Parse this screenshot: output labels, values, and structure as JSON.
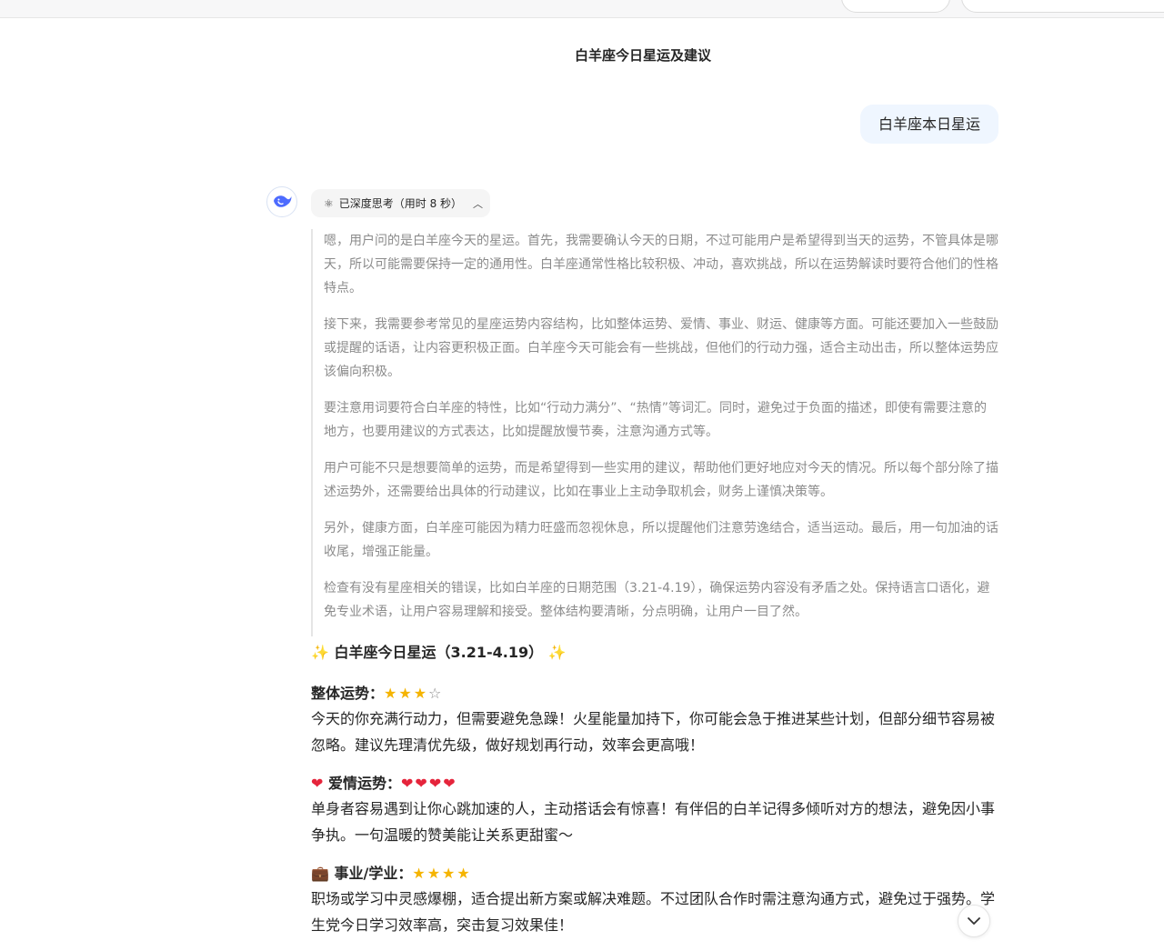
{
  "conversation": {
    "title": "白羊座今日星运及建议"
  },
  "user_message": {
    "text": "白羊座本日星运"
  },
  "assistant": {
    "thinking_label": "已深度思考（用时 8 秒）",
    "thinking_paragraphs": [
      "嗯，用户问的是白羊座今天的星运。首先，我需要确认今天的日期，不过可能用户是希望得到当天的运势，不管具体是哪天，所以可能需要保持一定的通用性。白羊座通常性格比较积极、冲动，喜欢挑战，所以在运势解读时要符合他们的性格特点。",
      "接下来，我需要参考常见的星座运势内容结构，比如整体运势、爱情、事业、财运、健康等方面。可能还要加入一些鼓励或提醒的话语，让内容更积极正面。白羊座今天可能会有一些挑战，但他们的行动力强，适合主动出击，所以整体运势应该偏向积极。",
      "要注意用词要符合白羊座的特性，比如“行动力满分”、“热情”等词汇。同时，避免过于负面的描述，即使有需要注意的地方，也要用建议的方式表达，比如提醒放慢节奏，注意沟通方式等。",
      "用户可能不只是想要简单的运势，而是希望得到一些实用的建议，帮助他们更好地应对今天的情况。所以每个部分除了描述运势外，还需要给出具体的行动建议，比如在事业上主动争取机会，财务上谨慎决策等。",
      "另外，健康方面，白羊座可能因为精力旺盛而忽视休息，所以提醒他们注意劳逸结合，适当运动。最后，用一句加油的话收尾，增强正能量。",
      "检查有没有星座相关的错误，比如白羊座的日期范围（3.21-4.19），确保运势内容没有矛盾之处。保持语言口语化，避免专业术语，让用户容易理解和接受。整体结构要清晰，分点明确，让用户一目了然。"
    ],
    "answer": {
      "heading": "白羊座今日星运（3.21-4.19）",
      "sections": [
        {
          "title": "整体运势：",
          "rating": 3,
          "rating_max": 4,
          "rating_symbol": "star",
          "body": "今天的你充满行动力，但需要避免急躁！火星能量加持下，你可能会急于推进某些计划，但部分细节容易被忽略。建议先理清优先级，做好规划再行动，效率会更高哦！"
        },
        {
          "title": "爱情运势：",
          "rating": 4,
          "rating_max": 4,
          "rating_symbol": "heart",
          "body": "单身者容易遇到让你心跳加速的人，主动搭话会有惊喜！有伴侣的白羊记得多倾听对方的想法，避免因小事争执。一句温暖的赞美能让关系更甜蜜～"
        },
        {
          "title": "事业/学业：",
          "rating": 4,
          "rating_max": 4,
          "rating_symbol": "star",
          "body": "职场或学习中灵感爆棚，适合提出新方案或解决难题。不过团队合作时需注意沟通方式，避免过于强势。学生党今日学习效率高，突击复习效果佳！"
        }
      ]
    }
  }
}
